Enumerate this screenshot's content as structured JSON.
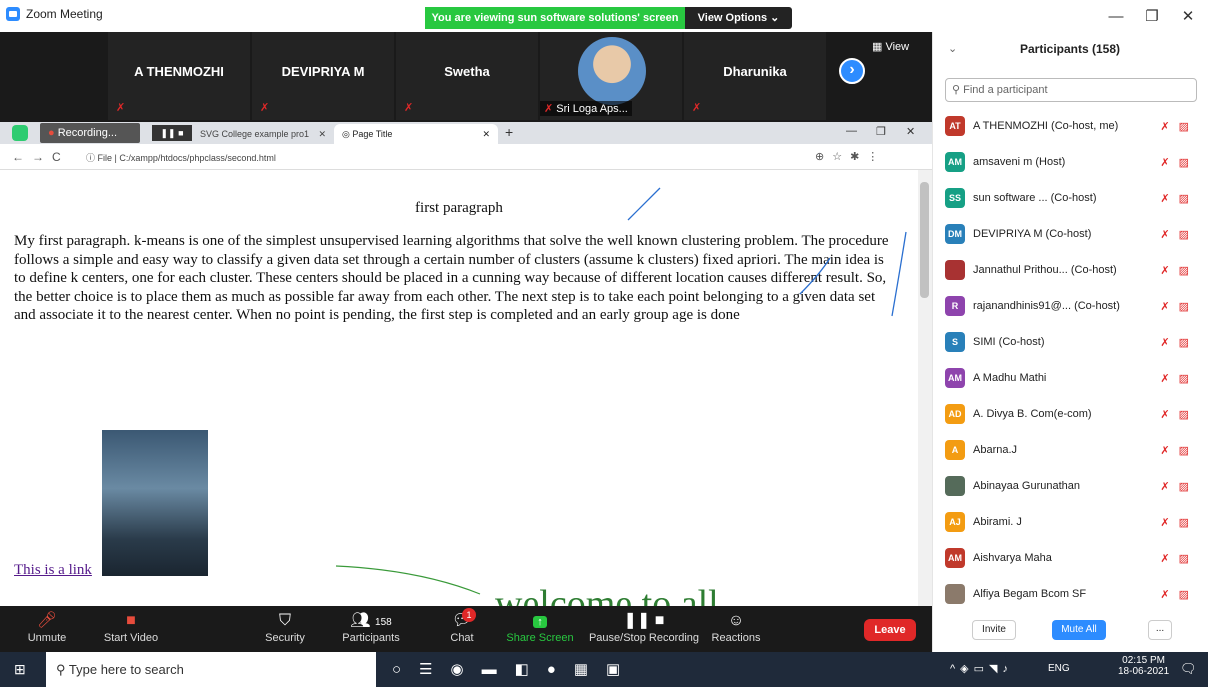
{
  "window": {
    "title": "Zoom Meeting",
    "minimize": "—",
    "maximize": "❐",
    "close": "✕"
  },
  "banner": {
    "sharing_text": "You are viewing sun software solutions' screen",
    "view_options": "View Options ⌄"
  },
  "videos": {
    "tiles": [
      {
        "name": "A THENMOZHI"
      },
      {
        "name": "DEVIPRIYA M"
      },
      {
        "name": "Swetha"
      },
      {
        "name": "Sri Loga Aps..."
      },
      {
        "name": "Dharunika"
      }
    ],
    "view_label": "View"
  },
  "recording": {
    "label": "Recording..."
  },
  "browser": {
    "tabs": [
      {
        "title": "SVG College example pro1"
      },
      {
        "title": "Page Title"
      }
    ],
    "url": "File | C:/xampp/htdocs/phpclass/second.html"
  },
  "page": {
    "heading": "first paragraph",
    "paragraph": "My first paragraph. k-means is one of the simplest unsupervised learning algorithms that solve the well known clustering problem. The procedure follows a simple and easy way to classify a given data set through a certain number of clusters (assume k clusters) fixed apriori. The main idea is to define k centers, one for each cluster. These centers should be placed in a cunning way because of different location causes different result. So, the better choice is to place them as much as possible far away from each other. The next step is to take each point belonging to a given data set and associate it to the nearest center. When no point is pending, the first step is completed and an early group age is done",
    "link": "This is a link",
    "marquee": "welcome to all"
  },
  "toolbar": {
    "unmute": "Unmute",
    "start_video": "Start Video",
    "security": "Security",
    "participants": "Participants",
    "participants_count": "158",
    "chat": "Chat",
    "chat_badge": "1",
    "share_screen": "Share Screen",
    "pause_stop": "Pause/Stop Recording",
    "reactions": "Reactions",
    "leave": "Leave"
  },
  "participants": {
    "header": "Participants (158)",
    "search_placeholder": "Find a participant",
    "list": [
      {
        "initials": "AT",
        "name": "A THENMOZHI (Co-host, me)",
        "color": "#c0392b"
      },
      {
        "initials": "AM",
        "name": "amsaveni m (Host)",
        "color": "#16a085"
      },
      {
        "initials": "SS",
        "name": "sun software ... (Co-host)",
        "color": "#16a085"
      },
      {
        "initials": "DM",
        "name": "DEVIPRIYA M (Co-host)",
        "color": "#2980b9"
      },
      {
        "initials": "",
        "name": "Jannathul Prithou... (Co-host)",
        "color": "#a83232"
      },
      {
        "initials": "R",
        "name": "rajanandhinis91@... (Co-host)",
        "color": "#8e44ad"
      },
      {
        "initials": "S",
        "name": "SIMI (Co-host)",
        "color": "#2980b9"
      },
      {
        "initials": "AM",
        "name": "A Madhu Mathi",
        "color": "#8e44ad"
      },
      {
        "initials": "AD",
        "name": "A. Divya B. Com(e-com)",
        "color": "#f39c12"
      },
      {
        "initials": "A",
        "name": "Abarna.J",
        "color": "#f39c12"
      },
      {
        "initials": "",
        "name": "Abinayaa Gurunathan",
        "color": "#556b5a"
      },
      {
        "initials": "AJ",
        "name": "Abirami. J",
        "color": "#f39c12"
      },
      {
        "initials": "AM",
        "name": "Aishvarya Maha",
        "color": "#c0392b"
      },
      {
        "initials": "",
        "name": "Alfiya Begam Bcom SF",
        "color": "#8b7a6b"
      }
    ],
    "invite": "Invite",
    "mute_all": "Mute All",
    "more": "..."
  },
  "taskbar": {
    "search_placeholder": "Type here to search",
    "lang": "ENG",
    "time": "02:15 PM",
    "date": "18-06-2021"
  }
}
